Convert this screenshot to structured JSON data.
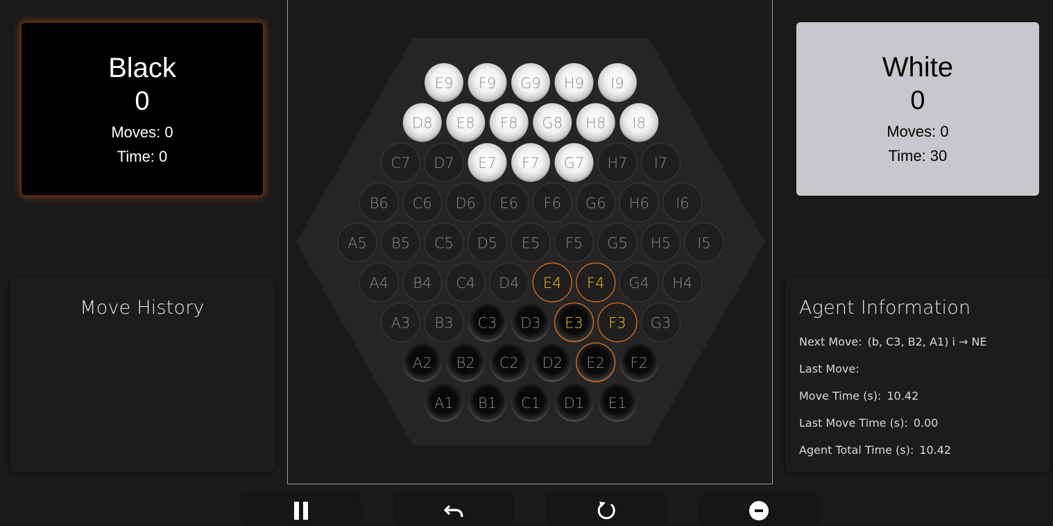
{
  "players": {
    "black": {
      "name": "Black",
      "score": "0",
      "moves": "Moves: 0",
      "time": "Time: 0"
    },
    "white": {
      "name": "White",
      "score": "0",
      "moves": "Moves: 0",
      "time": "Time: 30"
    }
  },
  "history": {
    "title": "Move History"
  },
  "agent": {
    "title": "Agent Information",
    "next_move_label": "Next Move:",
    "next_move_value": "(b, C3, B2, A1) i → NE",
    "last_move_label": "Last Move:",
    "last_move_value": "",
    "move_time_label": "Move Time (s):",
    "move_time_value": "10.42",
    "last_move_time_label": "Last Move Time (s):",
    "last_move_time_value": "0.00",
    "total_time_label": "Agent Total Time (s):",
    "total_time_value": "10.42"
  },
  "board": {
    "rows": [
      {
        "cells": [
          {
            "label": "E9",
            "piece": "white"
          },
          {
            "label": "F9",
            "piece": "white"
          },
          {
            "label": "G9",
            "piece": "white"
          },
          {
            "label": "H9",
            "piece": "white"
          },
          {
            "label": "I9",
            "piece": "white"
          }
        ]
      },
      {
        "cells": [
          {
            "label": "D8",
            "piece": "white"
          },
          {
            "label": "E8",
            "piece": "white"
          },
          {
            "label": "F8",
            "piece": "white"
          },
          {
            "label": "G8",
            "piece": "white"
          },
          {
            "label": "H8",
            "piece": "white"
          },
          {
            "label": "I8",
            "piece": "white"
          }
        ]
      },
      {
        "cells": [
          {
            "label": "C7",
            "piece": "empty"
          },
          {
            "label": "D7",
            "piece": "empty"
          },
          {
            "label": "E7",
            "piece": "white"
          },
          {
            "label": "F7",
            "piece": "white"
          },
          {
            "label": "G7",
            "piece": "white"
          },
          {
            "label": "H7",
            "piece": "empty"
          },
          {
            "label": "I7",
            "piece": "empty"
          }
        ]
      },
      {
        "cells": [
          {
            "label": "B6",
            "piece": "empty"
          },
          {
            "label": "C6",
            "piece": "empty"
          },
          {
            "label": "D6",
            "piece": "empty"
          },
          {
            "label": "E6",
            "piece": "empty"
          },
          {
            "label": "F6",
            "piece": "empty"
          },
          {
            "label": "G6",
            "piece": "empty"
          },
          {
            "label": "H6",
            "piece": "empty"
          },
          {
            "label": "I6",
            "piece": "empty"
          }
        ]
      },
      {
        "cells": [
          {
            "label": "A5",
            "piece": "empty"
          },
          {
            "label": "B5",
            "piece": "empty"
          },
          {
            "label": "C5",
            "piece": "empty"
          },
          {
            "label": "D5",
            "piece": "empty"
          },
          {
            "label": "E5",
            "piece": "empty"
          },
          {
            "label": "F5",
            "piece": "empty"
          },
          {
            "label": "G5",
            "piece": "empty"
          },
          {
            "label": "H5",
            "piece": "empty"
          },
          {
            "label": "I5",
            "piece": "empty"
          }
        ]
      },
      {
        "cells": [
          {
            "label": "A4",
            "piece": "empty"
          },
          {
            "label": "B4",
            "piece": "empty"
          },
          {
            "label": "C4",
            "piece": "empty"
          },
          {
            "label": "D4",
            "piece": "empty"
          },
          {
            "label": "E4",
            "piece": "empty",
            "highlight": true
          },
          {
            "label": "F4",
            "piece": "empty",
            "highlight": true
          },
          {
            "label": "G4",
            "piece": "empty"
          },
          {
            "label": "H4",
            "piece": "empty"
          }
        ]
      },
      {
        "cells": [
          {
            "label": "A3",
            "piece": "empty"
          },
          {
            "label": "B3",
            "piece": "empty"
          },
          {
            "label": "C3",
            "piece": "black"
          },
          {
            "label": "D3",
            "piece": "black"
          },
          {
            "label": "E3",
            "piece": "black",
            "highlight": true
          },
          {
            "label": "F3",
            "piece": "empty",
            "highlight": true
          },
          {
            "label": "G3",
            "piece": "empty"
          }
        ]
      },
      {
        "cells": [
          {
            "label": "A2",
            "piece": "black"
          },
          {
            "label": "B2",
            "piece": "black"
          },
          {
            "label": "C2",
            "piece": "black"
          },
          {
            "label": "D2",
            "piece": "black"
          },
          {
            "label": "E2",
            "piece": "black",
            "highlight": true,
            "plain": true
          },
          {
            "label": "F2",
            "piece": "black"
          }
        ]
      },
      {
        "cells": [
          {
            "label": "A1",
            "piece": "black"
          },
          {
            "label": "B1",
            "piece": "black"
          },
          {
            "label": "C1",
            "piece": "black"
          },
          {
            "label": "D1",
            "piece": "black"
          },
          {
            "label": "E1",
            "piece": "black"
          }
        ]
      }
    ]
  },
  "colors": {
    "highlight": "#f0c419",
    "highlight_ring": "#d2691e",
    "label_gray": "#8a8a94"
  },
  "controls": [
    {
      "name": "pause-button",
      "icon": "pause-icon"
    },
    {
      "name": "undo-button",
      "icon": "undo-icon"
    },
    {
      "name": "restart-button",
      "icon": "restart-icon"
    },
    {
      "name": "stop-button",
      "icon": "stop-icon"
    }
  ]
}
